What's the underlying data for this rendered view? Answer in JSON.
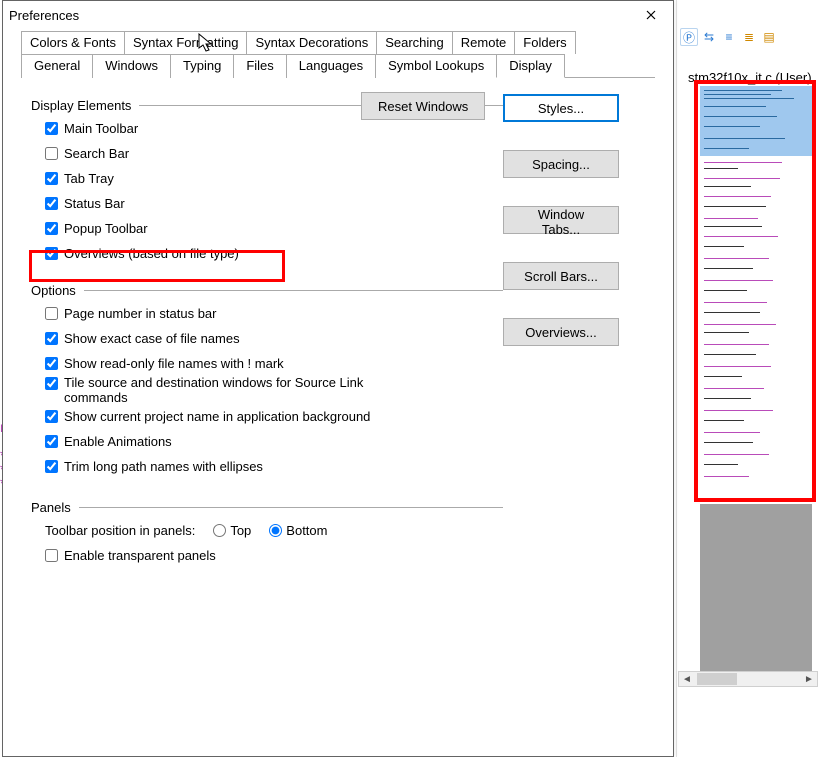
{
  "dialog": {
    "title": "Preferences",
    "tabs_row1": [
      "Colors & Fonts",
      "Syntax Formatting",
      "Syntax Decorations",
      "Searching",
      "Remote",
      "Folders"
    ],
    "tabs_row2": [
      "General",
      "Windows",
      "Typing",
      "Files",
      "Languages",
      "Symbol Lookups",
      "Display"
    ],
    "active_tab": "Display"
  },
  "display_elements": {
    "header": "Display Elements",
    "items": [
      {
        "label": "Main Toolbar",
        "checked": true
      },
      {
        "label": "Search Bar",
        "checked": false
      },
      {
        "label": "Tab Tray",
        "checked": true
      },
      {
        "label": "Status Bar",
        "checked": true
      },
      {
        "label": "Popup Toolbar",
        "checked": true
      },
      {
        "label": "Overviews (based on file type)",
        "checked": true
      }
    ]
  },
  "options": {
    "header": "Options",
    "items": [
      {
        "label": "Page number in status bar",
        "checked": false
      },
      {
        "label": "Show exact case of file names",
        "checked": true
      },
      {
        "label": "Show read-only file names with ! mark",
        "checked": true
      },
      {
        "label": "Tile source and destination windows for Source Link commands",
        "checked": true
      },
      {
        "label": "Show current project name in application background",
        "checked": true
      },
      {
        "label": "Enable Animations",
        "checked": true
      },
      {
        "label": "Trim long path names with ellipses",
        "checked": true
      }
    ]
  },
  "panels": {
    "header": "Panels",
    "toolbar_pos_label": "Toolbar position in panels:",
    "opts": [
      "Top",
      "Bottom"
    ],
    "selected": "Bottom",
    "transparent": {
      "label": "Enable transparent panels",
      "checked": false
    }
  },
  "buttons": {
    "reset": "Reset Windows",
    "styles": "Styles...",
    "spacing": "Spacing...",
    "window_tabs": "Window Tabs...",
    "scroll_bars": "Scroll Bars...",
    "overviews": "Overviews..."
  },
  "background": {
    "tab_label": "stm32f10x_it.c (User)",
    "toolbar_icons": [
      "p-circle-icon",
      "align-icon",
      "indent-left-icon",
      "indent-right-icon",
      "toggle-icon"
    ]
  }
}
